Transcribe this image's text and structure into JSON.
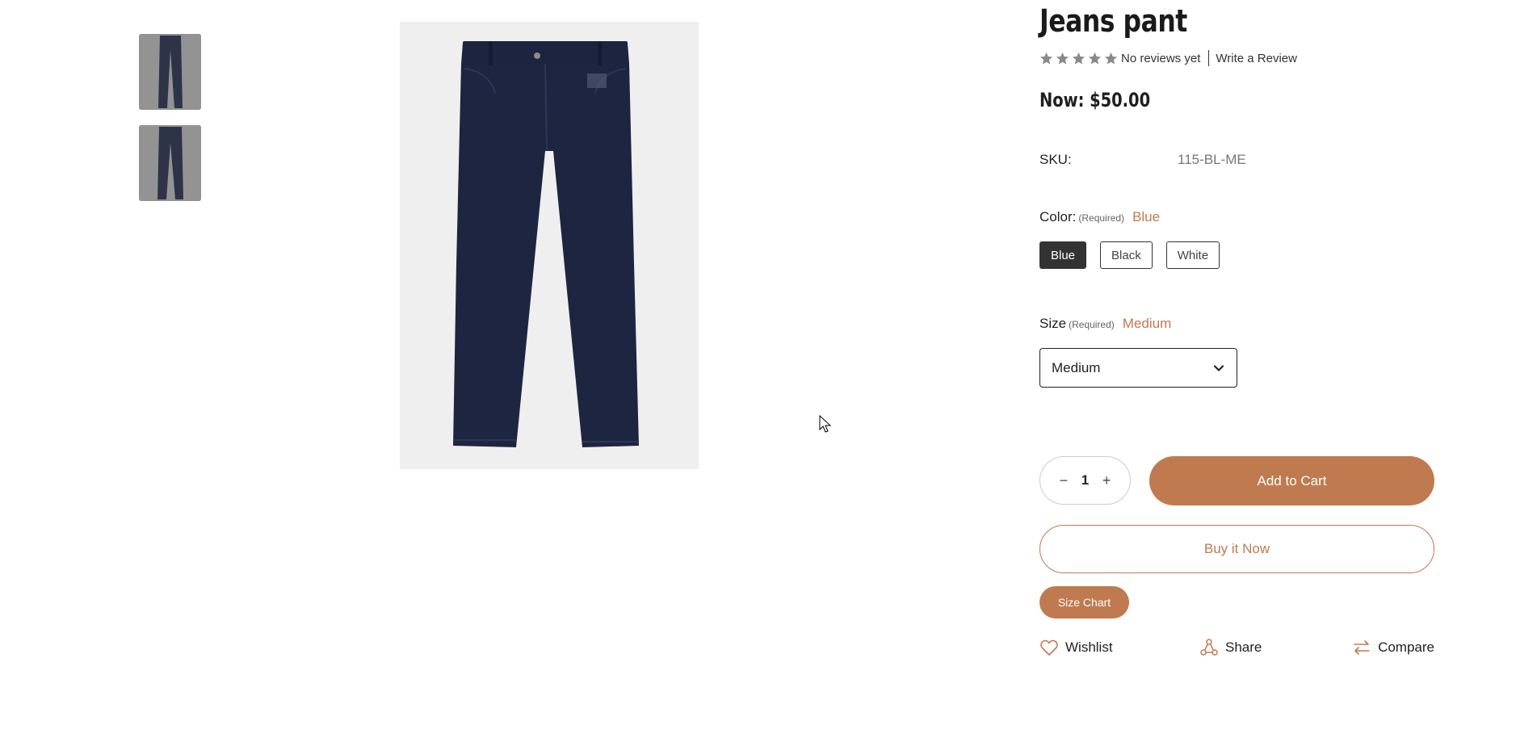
{
  "gallery": {
    "thumbnail_icons": [
      "jeans-thumbnail",
      "jeans-thumbnail-alt"
    ],
    "main_image_icon": "jeans-image"
  },
  "product": {
    "title": "Jeans pant",
    "rating": {
      "stars": 5,
      "star_color": "#8a8a8a",
      "reviews_text": "No reviews yet",
      "write_review": "Write a Review"
    },
    "price": "Now: $50.00",
    "sku": {
      "label": "SKU:",
      "value": "115-BL-ME"
    },
    "color": {
      "label": "Color:",
      "required": "(Required)",
      "selected": "Blue",
      "options": [
        "Blue",
        "Black",
        "White"
      ]
    },
    "size": {
      "label": "Size",
      "required": "(Required)",
      "selected_label": "Medium",
      "select_value": "Medium"
    },
    "quantity": {
      "minus": "−",
      "value": "1",
      "plus": "+"
    },
    "add_to_cart": "Add to Cart",
    "buy_now": "Buy it Now",
    "size_chart": "Size Chart",
    "actions": {
      "wishlist": "Wishlist",
      "share": "Share",
      "compare": "Compare"
    }
  },
  "colors": {
    "accent": "#c07a50",
    "dark_swatch": "#333333",
    "denim": "#1d2540"
  }
}
